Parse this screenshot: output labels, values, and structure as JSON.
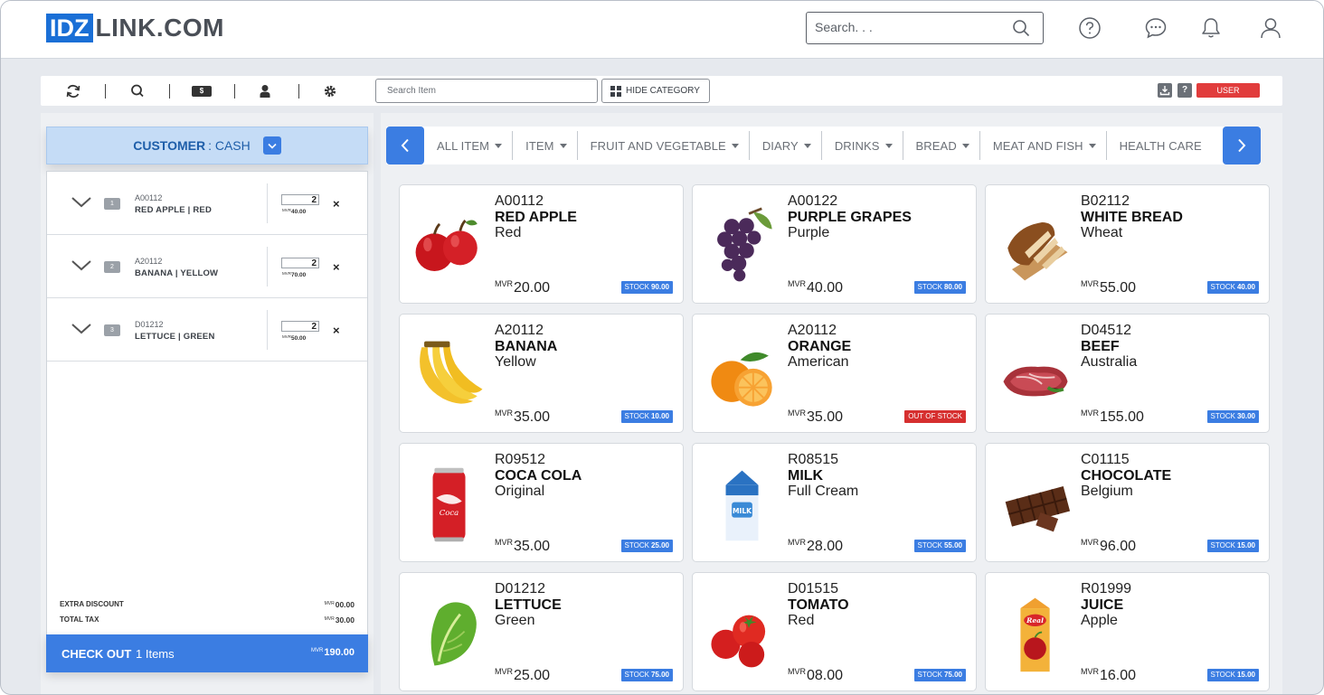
{
  "header": {
    "logo_box": "IDZ",
    "logo_rest": "LINK.COM",
    "search_placeholder": "Search. . ."
  },
  "toolbar": {
    "item_search_placeholder": "Search Item",
    "hide_category_label": "HIDE CATEGORY",
    "dollar_label": "$",
    "help_label": "?",
    "user_label": "USER"
  },
  "customer": {
    "label": "CUSTOMER",
    "value": ": CASH"
  },
  "cart": {
    "currency": "MVR",
    "rows": [
      {
        "index": "1",
        "code": "A00112",
        "name": "RED APPLE | RED",
        "qty": "2",
        "line_price": "40.00"
      },
      {
        "index": "2",
        "code": "A20112",
        "name": "BANANA | YELLOW",
        "qty": "2",
        "line_price": "70.00"
      },
      {
        "index": "3",
        "code": "D01212",
        "name": "LETTUCE | GREEN",
        "qty": "2",
        "line_price": "50.00"
      }
    ],
    "extra_discount_label": "EXTRA DISCOUNT",
    "extra_discount_value": "00.00",
    "total_tax_label": "TOTAL TAX",
    "total_tax_value": "30.00",
    "checkout_label": "CHECK OUT",
    "checkout_count": "1 Items",
    "checkout_total": "190.00"
  },
  "categories": [
    "ALL ITEM",
    "ITEM",
    "FRUIT AND VEGETABLE",
    "DIARY",
    "DRINKS",
    "BREAD",
    "MEAT AND FISH",
    "HEALTH CARE"
  ],
  "products": [
    {
      "code": "A00112",
      "name": "RED APPLE",
      "sub": "Red",
      "price": "20.00",
      "stock_label": "STOCK",
      "stock_value": "90.00",
      "out": false,
      "icon": "apple-icon"
    },
    {
      "code": "A00122",
      "name": "PURPLE GRAPES",
      "sub": "Purple",
      "price": "40.00",
      "stock_label": "STOCK",
      "stock_value": "80.00",
      "out": false,
      "icon": "grapes-icon"
    },
    {
      "code": "B02112",
      "name": "WHITE BREAD",
      "sub": "Wheat",
      "price": "55.00",
      "stock_label": "STOCK",
      "stock_value": "40.00",
      "out": false,
      "icon": "bread-icon"
    },
    {
      "code": "A20112",
      "name": "BANANA",
      "sub": "Yellow",
      "price": "35.00",
      "stock_label": "STOCK",
      "stock_value": "10.00",
      "out": false,
      "icon": "banana-icon"
    },
    {
      "code": "A20112",
      "name": "ORANGE",
      "sub": "American",
      "price": "35.00",
      "stock_label": "OUT OF STOCK",
      "stock_value": "",
      "out": true,
      "icon": "orange-icon"
    },
    {
      "code": "D04512",
      "name": "BEEF",
      "sub": "Australia",
      "price": "155.00",
      "stock_label": "STOCK",
      "stock_value": "30.00",
      "out": false,
      "icon": "beef-icon"
    },
    {
      "code": "R09512",
      "name": "COCA COLA",
      "sub": "Original",
      "price": "35.00",
      "stock_label": "STOCK",
      "stock_value": "25.00",
      "out": false,
      "icon": "cola-can-icon"
    },
    {
      "code": "R08515",
      "name": "MILK",
      "sub": "Full Cream",
      "price": "28.00",
      "stock_label": "STOCK",
      "stock_value": "55.00",
      "out": false,
      "icon": "milk-carton-icon"
    },
    {
      "code": "C01115",
      "name": "CHOCOLATE",
      "sub": "Belgium",
      "price": "96.00",
      "stock_label": "STOCK",
      "stock_value": "15.00",
      "out": false,
      "icon": "chocolate-icon"
    },
    {
      "code": "D01212",
      "name": "LETTUCE",
      "sub": "Green",
      "price": "25.00",
      "stock_label": "STOCK",
      "stock_value": "75.00",
      "out": false,
      "icon": "lettuce-icon"
    },
    {
      "code": "D01515",
      "name": "TOMATO",
      "sub": "Red",
      "price": "08.00",
      "stock_label": "STOCK",
      "stock_value": "75.00",
      "out": false,
      "icon": "tomato-icon"
    },
    {
      "code": "R01999",
      "name": "JUICE",
      "sub": "Apple",
      "price": "16.00",
      "stock_label": "STOCK",
      "stock_value": "15.00",
      "out": false,
      "icon": "juice-carton-icon"
    }
  ],
  "colors": {
    "accent": "#3b7de2",
    "brand": "#1a6fd6",
    "danger": "#e13c3c",
    "out_of_stock": "#d62f2f",
    "customer_bar": "#c5dcf6"
  }
}
